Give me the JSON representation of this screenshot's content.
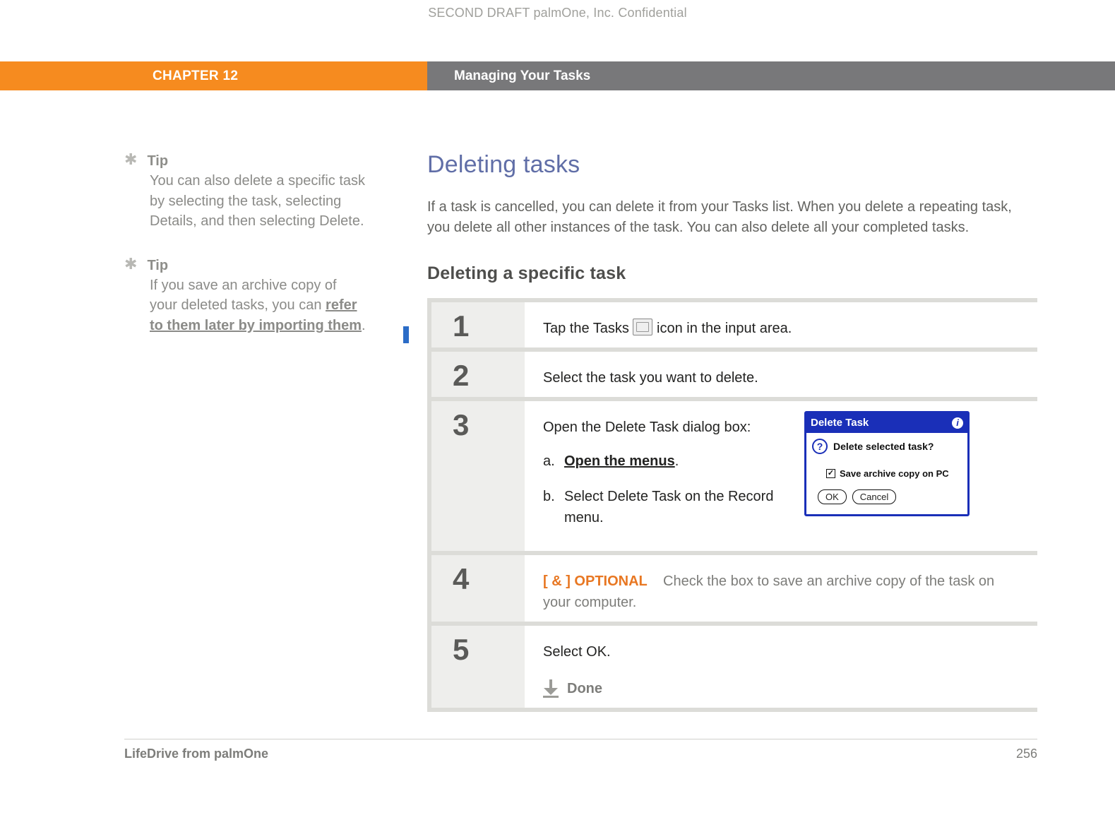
{
  "confidential": "SECOND DRAFT palmOne, Inc.  Confidential",
  "chapter_label": "CHAPTER 12",
  "chapter_title": "Managing Your Tasks",
  "sidebar": {
    "tips": [
      {
        "label": "Tip",
        "body": "You can also delete a specific task by selecting the task, selecting Details, and then selecting Delete.",
        "link": null
      },
      {
        "label": "Tip",
        "body_pre": "If you save an archive copy of your deleted tasks, you can ",
        "link": "refer to them later by importing them",
        "body_post": "."
      }
    ]
  },
  "main": {
    "h1": "Deleting tasks",
    "intro": "If a task is cancelled, you can delete it from your Tasks list. When you delete a repeating task, you delete all other instances of the task. You can also delete all your completed tasks.",
    "h2": "Deleting a specific task",
    "steps": [
      {
        "num": "1",
        "pre": "Tap the Tasks ",
        "post": " icon in the input area."
      },
      {
        "num": "2",
        "text": "Select the task you want to delete."
      },
      {
        "num": "3",
        "text": "Open the Delete Task dialog box:",
        "sub_a_letter": "a.",
        "sub_a_text": "Open the menus",
        "sub_a_post": ".",
        "sub_b_letter": "b.",
        "sub_b_text": "Select Delete Task on the Record menu."
      },
      {
        "num": "4",
        "optional_tag": "[ & ]  OPTIONAL",
        "optional_text": "Check the box to save an archive copy of the task on your computer."
      },
      {
        "num": "5",
        "text": "Select OK.",
        "done": "Done"
      }
    ],
    "dialog": {
      "title": "Delete Task",
      "question": "Delete selected task?",
      "checkbox": "Save archive copy on PC",
      "ok": "OK",
      "cancel": "Cancel"
    }
  },
  "footer": {
    "left": "LifeDrive from palmOne",
    "right": "256"
  }
}
